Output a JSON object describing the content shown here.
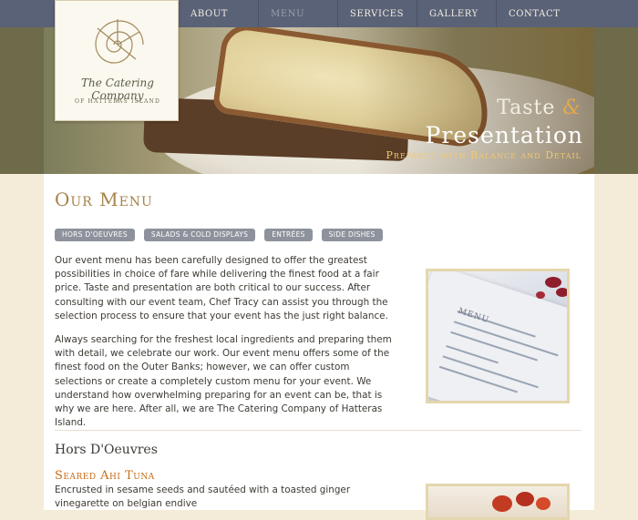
{
  "nav": {
    "items": [
      {
        "label": "About"
      },
      {
        "label": "Menu"
      },
      {
        "label": "Services"
      },
      {
        "label": "Gallery"
      },
      {
        "label": "Contact"
      }
    ]
  },
  "logo": {
    "name": "The Catering Company",
    "sub": "OF HATTERAS ISLAND"
  },
  "banner": {
    "line1": "Taste",
    "amp": "&",
    "line2": "Presentation",
    "line3": "Prepared with Balance and Detail"
  },
  "content": {
    "title": "Our Menu",
    "tabs": [
      {
        "label": "Hors D'oeuvres"
      },
      {
        "label": "Salads & Cold Displays"
      },
      {
        "label": "Entrées"
      },
      {
        "label": "Side Dishes"
      }
    ],
    "paragraph1": "Our event menu has been carefully designed to offer the greatest possibilities in choice of fare while delivering the finest food at a fair price. Taste and presentation are both critical to our success. After consulting with our event team, Chef Tracy can assist you through the selection process to ensure that your event has the just right balance.",
    "paragraph2": "Always searching for the freshest local ingredients and preparing them with detail, we celebrate our work. Our event menu offers some of the finest food on the Outer Banks; however, we can offer custom selections or create a completely custom menu for your event. We understand how overwhelming preparing for an event can be, that is why we are here. After all, we are The Catering Company of Hatteras Island.",
    "menu_photo_word": "MENU",
    "section_title": "Hors D'Oeuvres",
    "item": {
      "title": "Seared Ahi Tuna",
      "description": "Encrusted in sesame seeds and sautéed with a toasted ginger vinegarette on belgian endive"
    }
  }
}
